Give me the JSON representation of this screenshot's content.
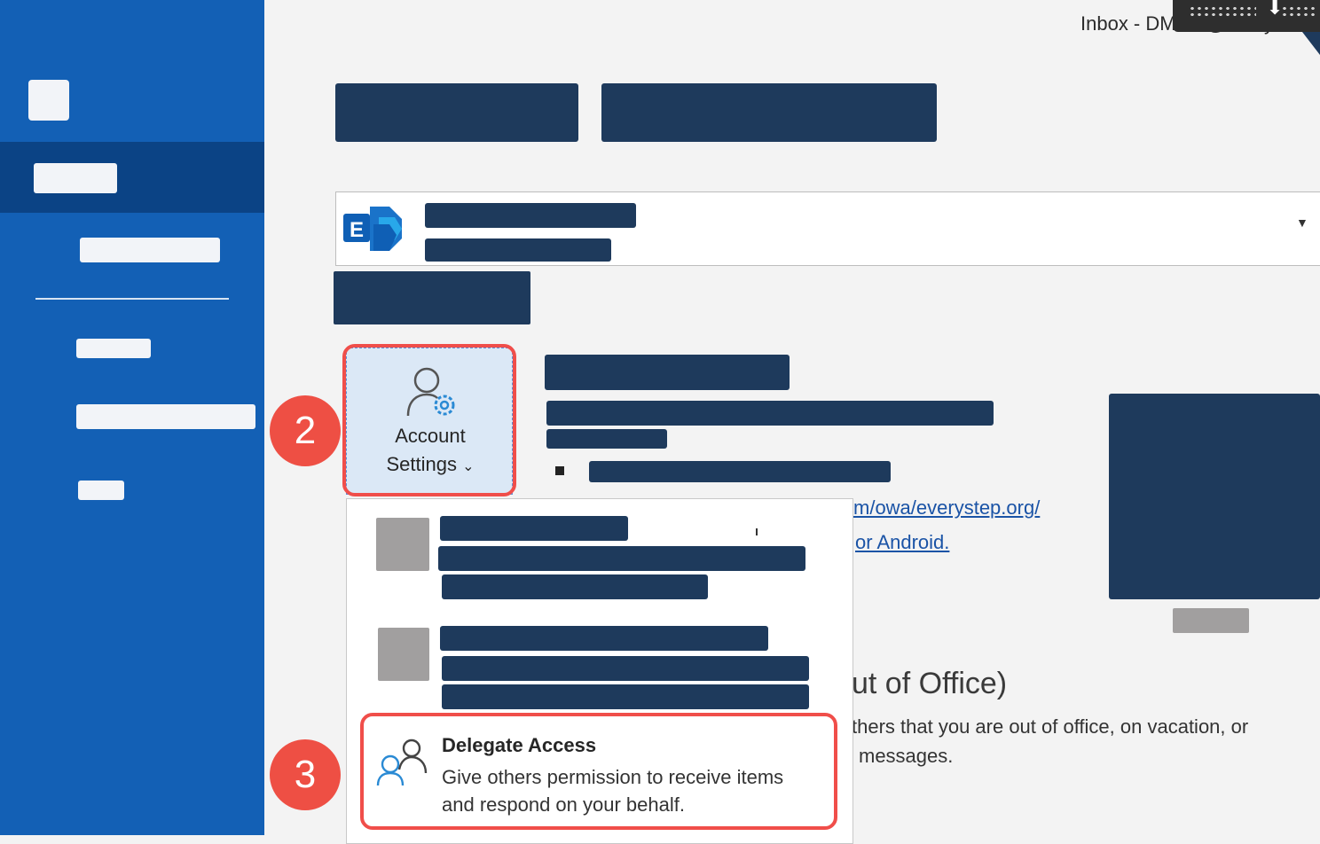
{
  "window": {
    "title": "Inbox - DMiller@everyst"
  },
  "account_settings": {
    "label_line1": "Account",
    "label_line2": "Settings",
    "chevron": "⌄",
    "icon": "account-settings-icon"
  },
  "steps": {
    "step2": "2",
    "step3": "3"
  },
  "dropdown": {
    "delegate_access": {
      "title": "Delegate Access",
      "description_line1": "Give others permission to receive items",
      "description_line2": "and respond on your behalf.",
      "icon": "delegate-people-icon"
    }
  },
  "content": {
    "link_owa": "m/owa/everystep.org/",
    "link_android": "or Android.",
    "ooo_heading": "ut of Office)",
    "ooo_desc_line1": "thers that you are out of office, on vacation, or",
    "ooo_desc_line2": "messages."
  },
  "account_selector": {
    "icon": "exchange-icon",
    "dropdown_icon": "chevron-down-icon"
  },
  "colors": {
    "sidebar": "#1360b5",
    "sidebar_active": "#0b4385",
    "highlight": "#f04e4a",
    "redaction": "#1e3a5c"
  }
}
